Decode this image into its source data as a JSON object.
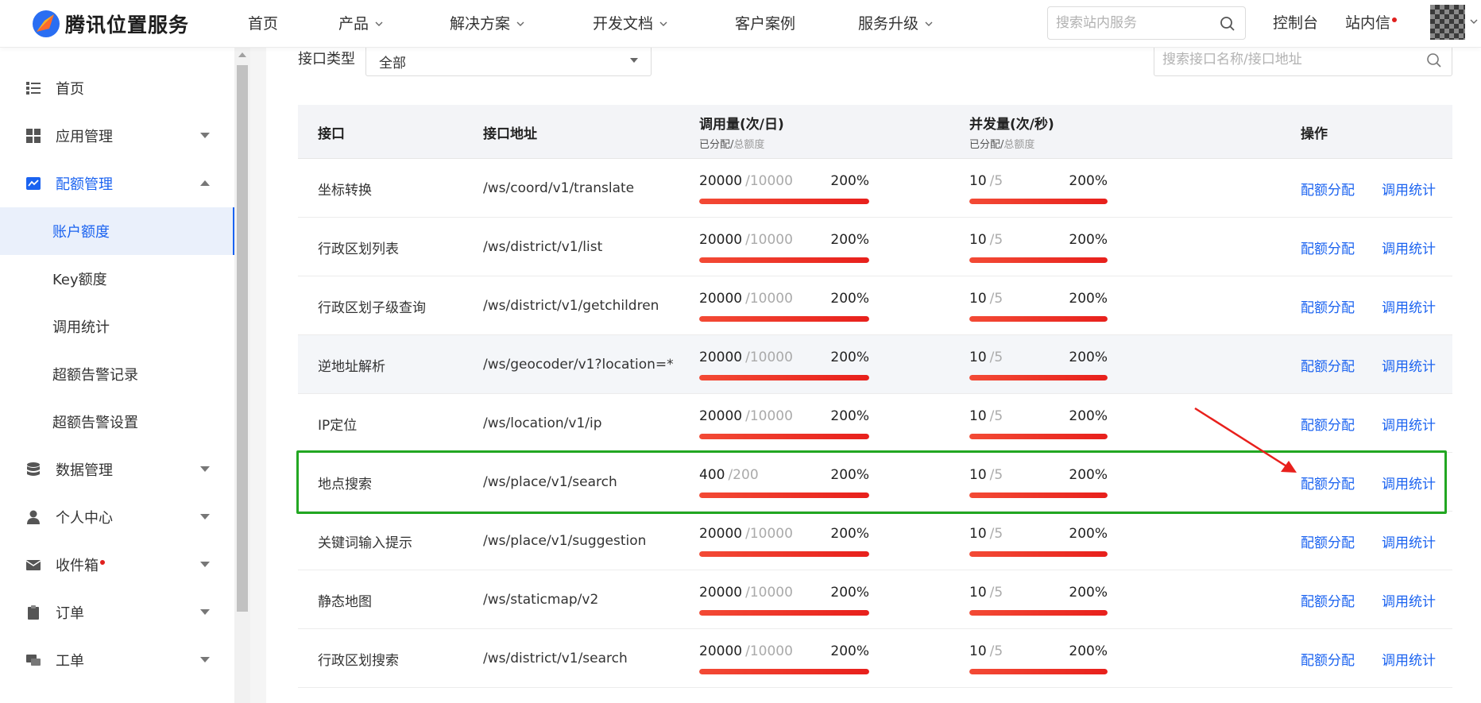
{
  "brand": {
    "name": "腾讯位置服务"
  },
  "topnav": {
    "items": [
      {
        "label": "首页",
        "has_dropdown": false
      },
      {
        "label": "产品",
        "has_dropdown": true
      },
      {
        "label": "解决方案",
        "has_dropdown": true
      },
      {
        "label": "开发文档",
        "has_dropdown": true
      },
      {
        "label": "客户案例",
        "has_dropdown": false
      },
      {
        "label": "服务升级",
        "has_dropdown": true
      }
    ],
    "search_placeholder": "搜索站内服务",
    "console": "控制台",
    "messages": "站内信"
  },
  "sidebar": {
    "items": [
      {
        "label": "首页",
        "icon": "list-icon"
      },
      {
        "label": "应用管理",
        "icon": "grid-icon"
      },
      {
        "label": "配额管理",
        "icon": "chart-icon"
      },
      {
        "label": "账户额度"
      },
      {
        "label": "Key额度"
      },
      {
        "label": "调用统计"
      },
      {
        "label": "超额告警记录"
      },
      {
        "label": "超额告警设置"
      },
      {
        "label": "数据管理",
        "icon": "database-icon"
      },
      {
        "label": "个人中心",
        "icon": "user-icon"
      },
      {
        "label": "收件箱",
        "icon": "mail-icon"
      },
      {
        "label": "订单",
        "icon": "clipboard-icon"
      },
      {
        "label": "工单",
        "icon": "ticket-icon"
      }
    ],
    "selected": "账户额度"
  },
  "filter": {
    "type_label": "接口类型",
    "type_value": "全部",
    "search_placeholder": "搜索接口名称/接口地址"
  },
  "table": {
    "headers": {
      "api": "接口",
      "address": "接口地址",
      "calls": "调用量(次/日)",
      "concurrency": "并发量(次/秒)",
      "sub_allocated": "已分配/",
      "sub_total": "总额度",
      "actions": "操作"
    },
    "rows": [
      {
        "name": "坐标转换",
        "path": "/ws/coord/v1/translate",
        "calls_used": "20000",
        "calls_total": "/10000",
        "calls_pct": "200%",
        "conc_used": "10",
        "conc_total": "/5",
        "conc_pct": "200%",
        "action1": "配额分配",
        "action2": "调用统计"
      },
      {
        "name": "行政区划列表",
        "path": "/ws/district/v1/list",
        "calls_used": "20000",
        "calls_total": "/10000",
        "calls_pct": "200%",
        "conc_used": "10",
        "conc_total": "/5",
        "conc_pct": "200%",
        "action1": "配额分配",
        "action2": "调用统计"
      },
      {
        "name": "行政区划子级查询",
        "path": "/ws/district/v1/getchildren",
        "calls_used": "20000",
        "calls_total": "/10000",
        "calls_pct": "200%",
        "conc_used": "10",
        "conc_total": "/5",
        "conc_pct": "200%",
        "action1": "配额分配",
        "action2": "调用统计"
      },
      {
        "name": "逆地址解析",
        "path": "/ws/geocoder/v1?location=*",
        "calls_used": "20000",
        "calls_total": "/10000",
        "calls_pct": "200%",
        "conc_used": "10",
        "conc_total": "/5",
        "conc_pct": "200%",
        "action1": "配额分配",
        "action2": "调用统计"
      },
      {
        "name": "IP定位",
        "path": "/ws/location/v1/ip",
        "calls_used": "20000",
        "calls_total": "/10000",
        "calls_pct": "200%",
        "conc_used": "10",
        "conc_total": "/5",
        "conc_pct": "200%",
        "action1": "配额分配",
        "action2": "调用统计"
      },
      {
        "name": "地点搜索",
        "path": "/ws/place/v1/search",
        "calls_used": "400",
        "calls_total": "/200",
        "calls_pct": "200%",
        "conc_used": "10",
        "conc_total": "/5",
        "conc_pct": "200%",
        "action1": "配额分配",
        "action2": "调用统计"
      },
      {
        "name": "关键词输入提示",
        "path": "/ws/place/v1/suggestion",
        "calls_used": "20000",
        "calls_total": "/10000",
        "calls_pct": "200%",
        "conc_used": "10",
        "conc_total": "/5",
        "conc_pct": "200%",
        "action1": "配额分配",
        "action2": "调用统计"
      },
      {
        "name": "静态地图",
        "path": "/ws/staticmap/v2",
        "calls_used": "20000",
        "calls_total": "/10000",
        "calls_pct": "200%",
        "conc_used": "10",
        "conc_total": "/5",
        "conc_pct": "200%",
        "action1": "配额分配",
        "action2": "调用统计"
      },
      {
        "name": "行政区划搜索",
        "path": "/ws/district/v1/search",
        "calls_used": "20000",
        "calls_total": "/10000",
        "calls_pct": "200%",
        "conc_used": "10",
        "conc_total": "/5",
        "conc_pct": "200%",
        "action1": "配额分配",
        "action2": "调用统计"
      }
    ]
  },
  "colors": {
    "accent": "#1b63f0",
    "bar": "#e8201c",
    "highlight": "#22a722",
    "annotation_arrow": "#e8201c"
  }
}
